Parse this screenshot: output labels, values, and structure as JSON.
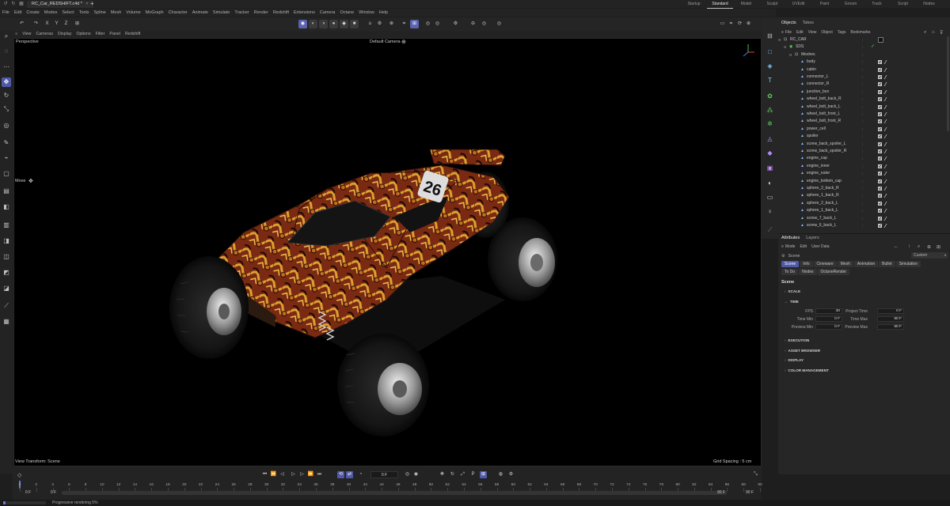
{
  "titlebar": {
    "doc_tab": "RC_Car_REDSHIFT.c4d *",
    "new_tab": "+",
    "layouts": [
      "Startup",
      "Standard",
      "Model",
      "Sculpt",
      "UVEdit",
      "Paint",
      "Groom",
      "Track",
      "Script",
      "Nodes"
    ],
    "active_layout": "Standard"
  },
  "menubar": [
    "File",
    "Edit",
    "Create",
    "Modes",
    "Select",
    "Tools",
    "Spline",
    "Mesh",
    "Volume",
    "MoGraph",
    "Character",
    "Animate",
    "Simulate",
    "Tracker",
    "Render",
    "Redshift",
    "Extensions",
    "Camera",
    "Octane",
    "Window",
    "Help"
  ],
  "toolbar": {
    "axis_x": "X",
    "axis_y": "Y",
    "axis_z": "Z"
  },
  "viewport": {
    "menu": [
      "View",
      "Cameras",
      "Display",
      "Options",
      "Filter",
      "Panel",
      "Redshift"
    ],
    "projection": "Perspective",
    "camera": "Default Camera",
    "camera_icon": "⊕",
    "move_label": "Move",
    "move_icon": "✥",
    "transform_label": "View Transform: Scene",
    "grid_spacing": "Grid Spacing : 5 cm",
    "car_number": "26"
  },
  "objects_panel": {
    "tabs": [
      "Objects",
      "Takes"
    ],
    "active_tab": "Objects",
    "menu": [
      "File",
      "Edit",
      "View",
      "Object",
      "Tags",
      "Bookmarks"
    ],
    "rows": [
      {
        "name": "RC_CAR",
        "indent": 0,
        "kind": "root"
      },
      {
        "name": "SDS",
        "indent": 1,
        "kind": "sds"
      },
      {
        "name": "Meshes",
        "indent": 2,
        "kind": "null"
      },
      {
        "name": "body",
        "indent": 3,
        "kind": "mesh"
      },
      {
        "name": "cabin",
        "indent": 3,
        "kind": "mesh"
      },
      {
        "name": "connector_L",
        "indent": 3,
        "kind": "mesh"
      },
      {
        "name": "connector_R",
        "indent": 3,
        "kind": "mesh"
      },
      {
        "name": "junction_box",
        "indent": 3,
        "kind": "mesh"
      },
      {
        "name": "wheel_bolt_back_R",
        "indent": 3,
        "kind": "mesh"
      },
      {
        "name": "wheel_bolt_back_L",
        "indent": 3,
        "kind": "mesh"
      },
      {
        "name": "wheel_bolt_front_L",
        "indent": 3,
        "kind": "mesh"
      },
      {
        "name": "wheel_bolt_front_R",
        "indent": 3,
        "kind": "mesh"
      },
      {
        "name": "power_cell",
        "indent": 3,
        "kind": "mesh"
      },
      {
        "name": "spoiler",
        "indent": 3,
        "kind": "mesh"
      },
      {
        "name": "screw_back_spoiler_L",
        "indent": 3,
        "kind": "mesh"
      },
      {
        "name": "screw_back_spoiler_R",
        "indent": 3,
        "kind": "mesh"
      },
      {
        "name": "engine_cap",
        "indent": 3,
        "kind": "mesh"
      },
      {
        "name": "engine_inner",
        "indent": 3,
        "kind": "mesh"
      },
      {
        "name": "engine_outer",
        "indent": 3,
        "kind": "mesh"
      },
      {
        "name": "engine_bottom_cap",
        "indent": 3,
        "kind": "mesh"
      },
      {
        "name": "sphere_2_back_R",
        "indent": 3,
        "kind": "mesh"
      },
      {
        "name": "sphere_1_back_R",
        "indent": 3,
        "kind": "mesh"
      },
      {
        "name": "sphere_2_back_L",
        "indent": 3,
        "kind": "mesh"
      },
      {
        "name": "sphere_1_back_L",
        "indent": 3,
        "kind": "mesh"
      },
      {
        "name": "screw_7_back_L",
        "indent": 3,
        "kind": "mesh"
      },
      {
        "name": "screw_6_back_L",
        "indent": 3,
        "kind": "mesh"
      }
    ]
  },
  "attributes_panel": {
    "tabs": [
      "Attributes",
      "Layers"
    ],
    "active_tab": "Attributes",
    "menu": [
      "Mode",
      "Edit",
      "User Data"
    ],
    "object_label": "Scene",
    "preset_value": "Custom",
    "chips_row1": [
      "Scene",
      "Info",
      "Cineware",
      "Mesh",
      "Animation",
      "Bullet",
      "Simulation"
    ],
    "chips_row2": [
      "To Do",
      "Nodes",
      "OctaneRender"
    ],
    "active_chip": "Scene",
    "heading": "Scene",
    "sections": {
      "scale": "SCALE",
      "time": "TIME",
      "execution": "EXECUTION",
      "asset_browser": "ASSET BROWSER",
      "display": "DISPLAY",
      "color_management": "COLOR MANAGEMENT"
    },
    "fields": {
      "fps_label": "FPS",
      "fps": "30",
      "project_time_label": "Project Time",
      "project_time": "0 F",
      "time_min_label": "Time Min",
      "time_min": "0 F",
      "time_max_label": "Time Max",
      "time_max": "90 F",
      "preview_min_label": "Preview Min",
      "preview_min": "0 F",
      "preview_max_label": "Preview Max",
      "preview_max": "90 F"
    }
  },
  "timeline": {
    "ticks": [
      "0",
      "2",
      "4",
      "6",
      "8",
      "10",
      "12",
      "14",
      "16",
      "18",
      "20",
      "22",
      "24",
      "26",
      "28",
      "30",
      "32",
      "34",
      "36",
      "38",
      "40",
      "42",
      "44",
      "46",
      "48",
      "50",
      "52",
      "54",
      "56",
      "58",
      "60",
      "62",
      "64",
      "66",
      "68",
      "70",
      "72",
      "74",
      "76",
      "78",
      "80",
      "82",
      "84",
      "86",
      "88",
      "90"
    ],
    "current_frame": "0 F",
    "start_a": "0 F",
    "start_b": "0 F",
    "end_a": "90 F",
    "end_b": "90 F"
  },
  "status": {
    "message": "Progressive rendering 5%"
  }
}
